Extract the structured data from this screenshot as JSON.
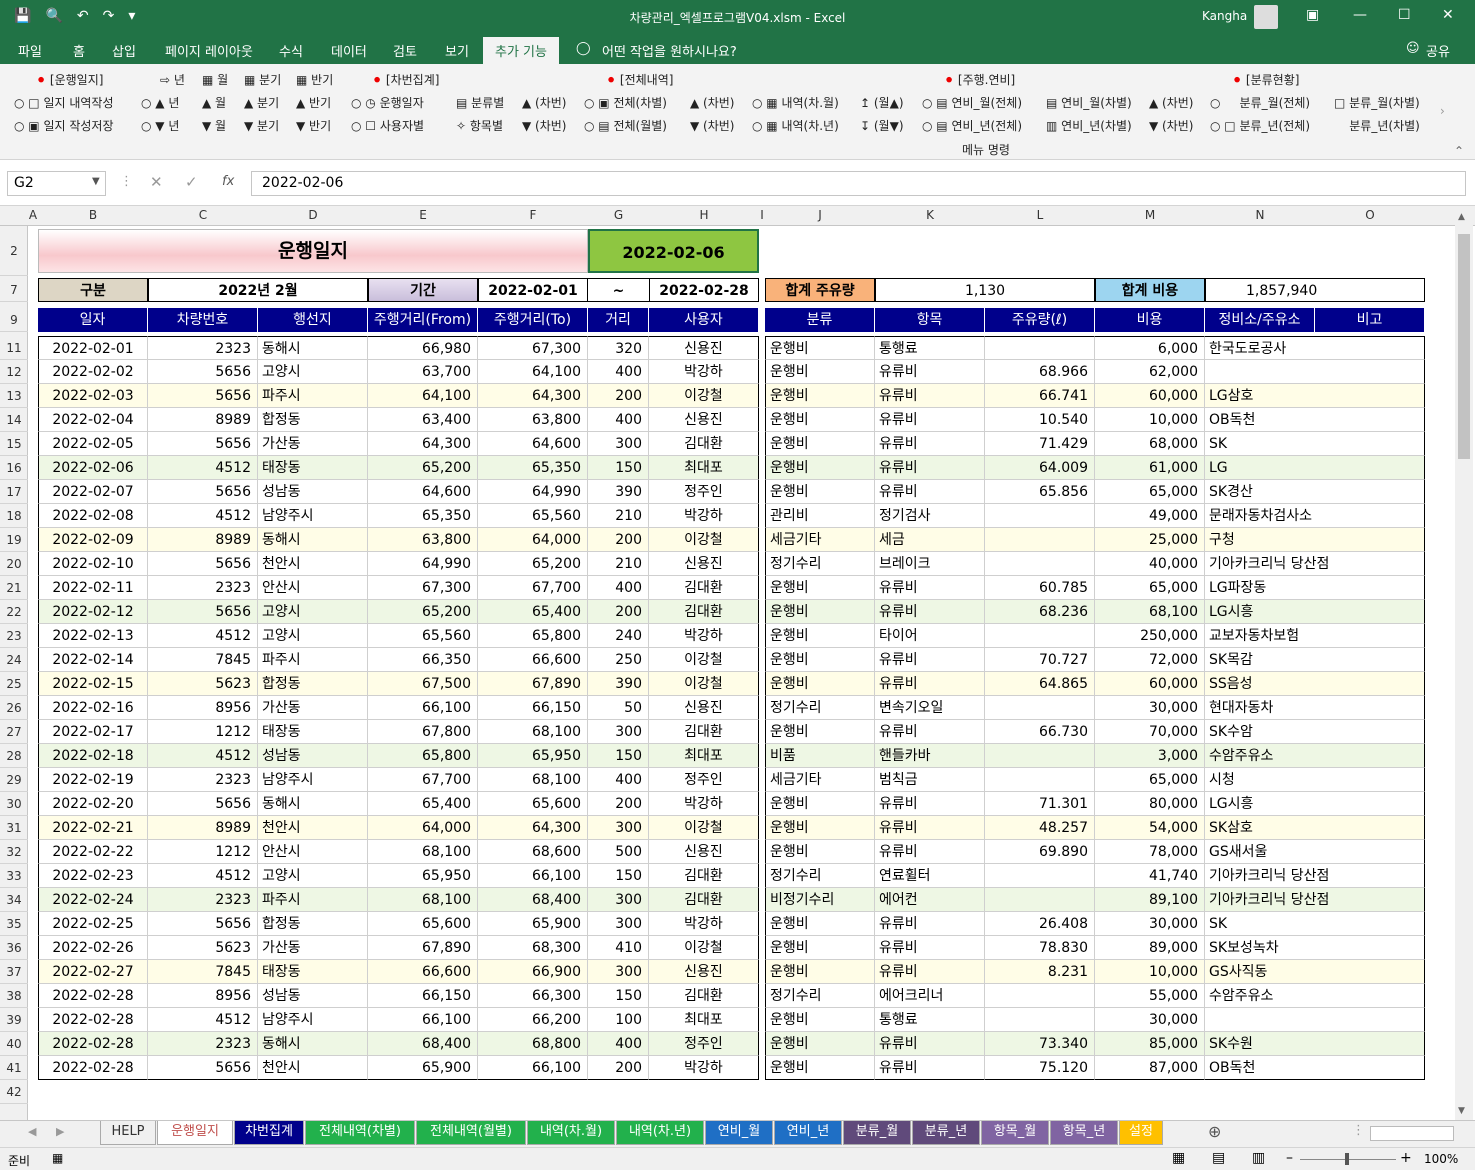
{
  "window": {
    "title": "차량관리_엑셀프로그램V04.xlsm  -  Excel",
    "user": "Kangha"
  },
  "tabs": [
    "파일",
    "홈",
    "삽입",
    "페이지 레이아웃",
    "수식",
    "데이터",
    "검토",
    "보기",
    "추가 기능"
  ],
  "tell_me": "어떤 작업을 원하시나요?",
  "share": "공유",
  "ribbon": {
    "groups": [
      "[운행일지]",
      "[차번집계]",
      "[전체내역]",
      "[주행.연비]",
      "[분류현황]"
    ],
    "row1": [
      "일지 내역작성",
      "년",
      "월",
      "분기",
      "반기",
      "운행일자",
      "분류별",
      "(차번)",
      "전체(차별)",
      "(차번)",
      "내역(차.월)",
      "(월▲)",
      "연비_월(전체)",
      "연비_월(차별)",
      "(차번)",
      "분류_월(전체)",
      "분류_월(차별)"
    ],
    "row2": [
      "일지 작성저장",
      "년",
      "월",
      "분기",
      "반기",
      "사용자별",
      "항목별",
      "(차번)",
      "전체(월별)",
      "(차번)",
      "내역(차.년)",
      "(월▼)",
      "연비_년(전체)",
      "연비_년(차별)",
      "(차번)",
      "분류_년(전체)",
      "분류_년(차별)"
    ],
    "row1b": [
      "년",
      "월",
      "분기",
      "반기"
    ],
    "footer": "메뉴 명령"
  },
  "formula": {
    "cell": "G2",
    "value": "2022-02-06",
    "fx": "fx"
  },
  "columns": [
    "A",
    "B",
    "C",
    "D",
    "E",
    "F",
    "G",
    "H",
    "I",
    "J",
    "K",
    "L",
    "M",
    "N",
    "O"
  ],
  "row_numbers": [
    "2",
    "7",
    "9",
    "11",
    "12",
    "13",
    "14",
    "15",
    "16",
    "17",
    "18",
    "19",
    "20",
    "21",
    "22",
    "23",
    "24",
    "25",
    "26",
    "27",
    "28",
    "29",
    "30",
    "31",
    "32",
    "33",
    "34",
    "35",
    "36",
    "37",
    "38",
    "39",
    "40",
    "41",
    "42"
  ],
  "sheet": {
    "title": "운행일지",
    "date": "2022-02-06",
    "label_gubun": "구분",
    "gubun": "2022년 2월",
    "label_period": "기간",
    "period_from": "2022-02-01",
    "tilde": "~",
    "period_to": "2022-02-28",
    "label_fuel": "합계 주유량",
    "fuel_total": "1,130",
    "label_cost": "합계 비용",
    "cost_total": "1,857,940",
    "left_headers": [
      "일자",
      "차량번호",
      "행선지",
      "주행거리(From)",
      "주행거리(To)",
      "거리",
      "사용자"
    ],
    "right_headers": [
      "분류",
      "항목",
      "주유량(ℓ)",
      "비용",
      "정비소/주유소",
      "비고"
    ],
    "rows": [
      [
        "2022-02-01",
        "2323",
        "동해시",
        "66,980",
        "67,300",
        "320",
        "신용진",
        "운행비",
        "통행료",
        "",
        "6,000",
        "한국도로공사"
      ],
      [
        "2022-02-02",
        "5656",
        "고양시",
        "63,700",
        "64,100",
        "400",
        "박강하",
        "운행비",
        "유류비",
        "68.966",
        "62,000",
        ""
      ],
      [
        "2022-02-03",
        "5656",
        "파주시",
        "64,100",
        "64,300",
        "200",
        "이강철",
        "운행비",
        "유류비",
        "66.741",
        "60,000",
        "LG삼호"
      ],
      [
        "2022-02-04",
        "8989",
        "합정동",
        "63,400",
        "63,800",
        "400",
        "신용진",
        "운행비",
        "유류비",
        "10.540",
        "10,000",
        "OB독천"
      ],
      [
        "2022-02-05",
        "5656",
        "가산동",
        "64,300",
        "64,600",
        "300",
        "김대환",
        "운행비",
        "유류비",
        "71.429",
        "68,000",
        "SK"
      ],
      [
        "2022-02-06",
        "4512",
        "태장동",
        "65,200",
        "65,350",
        "150",
        "최대포",
        "운행비",
        "유류비",
        "64.009",
        "61,000",
        "LG"
      ],
      [
        "2022-02-07",
        "5656",
        "성남동",
        "64,600",
        "64,990",
        "390",
        "정주인",
        "운행비",
        "유류비",
        "65.856",
        "65,000",
        "SK경산"
      ],
      [
        "2022-02-08",
        "4512",
        "남양주시",
        "65,350",
        "65,560",
        "210",
        "박강하",
        "관리비",
        "정기검사",
        "",
        "49,000",
        "문래자동차검사소"
      ],
      [
        "2022-02-09",
        "8989",
        "동해시",
        "63,800",
        "64,000",
        "200",
        "이강철",
        "세금기타",
        "세금",
        "",
        "25,000",
        "구청"
      ],
      [
        "2022-02-10",
        "5656",
        "천안시",
        "64,990",
        "65,200",
        "210",
        "신용진",
        "정기수리",
        "브레이크",
        "",
        "40,000",
        "기아카크리닉 당산점"
      ],
      [
        "2022-02-11",
        "2323",
        "안산시",
        "67,300",
        "67,700",
        "400",
        "김대환",
        "운행비",
        "유류비",
        "60.785",
        "65,000",
        "LG파장동"
      ],
      [
        "2022-02-12",
        "5656",
        "고양시",
        "65,200",
        "65,400",
        "200",
        "김대환",
        "운행비",
        "유류비",
        "68.236",
        "68,100",
        "LG시흥"
      ],
      [
        "2022-02-13",
        "4512",
        "고양시",
        "65,560",
        "65,800",
        "240",
        "박강하",
        "운행비",
        "타이어",
        "",
        "250,000",
        "교보자동차보험"
      ],
      [
        "2022-02-14",
        "7845",
        "파주시",
        "66,350",
        "66,600",
        "250",
        "이강철",
        "운행비",
        "유류비",
        "70.727",
        "72,000",
        "SK목감"
      ],
      [
        "2022-02-15",
        "5623",
        "합정동",
        "67,500",
        "67,890",
        "390",
        "이강철",
        "운행비",
        "유류비",
        "64.865",
        "60,000",
        "SS음성"
      ],
      [
        "2022-02-16",
        "8956",
        "가산동",
        "66,100",
        "66,150",
        "50",
        "신용진",
        "정기수리",
        "변속기오일",
        "",
        "30,000",
        "현대자동차"
      ],
      [
        "2022-02-17",
        "1212",
        "태장동",
        "67,800",
        "68,100",
        "300",
        "김대환",
        "운행비",
        "유류비",
        "66.730",
        "70,000",
        "SK수암"
      ],
      [
        "2022-02-18",
        "4512",
        "성남동",
        "65,800",
        "65,950",
        "150",
        "최대포",
        "비품",
        "핸들카바",
        "",
        "3,000",
        "수암주유소"
      ],
      [
        "2022-02-19",
        "2323",
        "남양주시",
        "67,700",
        "68,100",
        "400",
        "정주인",
        "세금기타",
        "범칙금",
        "",
        "65,000",
        "시청"
      ],
      [
        "2022-02-20",
        "5656",
        "동해시",
        "65,400",
        "65,600",
        "200",
        "박강하",
        "운행비",
        "유류비",
        "71.301",
        "80,000",
        "LG시흥"
      ],
      [
        "2022-02-21",
        "8989",
        "천안시",
        "64,000",
        "64,300",
        "300",
        "이강철",
        "운행비",
        "유류비",
        "48.257",
        "54,000",
        "SK삼호"
      ],
      [
        "2022-02-22",
        "1212",
        "안산시",
        "68,100",
        "68,600",
        "500",
        "신용진",
        "운행비",
        "유류비",
        "69.890",
        "78,000",
        "GS새서울"
      ],
      [
        "2022-02-23",
        "4512",
        "고양시",
        "65,950",
        "66,100",
        "150",
        "김대환",
        "정기수리",
        "연료휠터",
        "",
        "41,740",
        "기아카크리닉 당산점"
      ],
      [
        "2022-02-24",
        "2323",
        "파주시",
        "68,100",
        "68,400",
        "300",
        "김대환",
        "비정기수리",
        "에어컨",
        "",
        "89,100",
        "기아카크리닉 당산점"
      ],
      [
        "2022-02-25",
        "5656",
        "합정동",
        "65,600",
        "65,900",
        "300",
        "박강하",
        "운행비",
        "유류비",
        "26.408",
        "30,000",
        "SK"
      ],
      [
        "2022-02-26",
        "5623",
        "가산동",
        "67,890",
        "68,300",
        "410",
        "이강철",
        "운행비",
        "유류비",
        "78.830",
        "89,000",
        "SK보성녹차"
      ],
      [
        "2022-02-27",
        "7845",
        "태장동",
        "66,600",
        "66,900",
        "300",
        "신용진",
        "운행비",
        "유류비",
        "8.231",
        "10,000",
        "GS사직동"
      ],
      [
        "2022-02-28",
        "8956",
        "성남동",
        "66,150",
        "66,300",
        "150",
        "김대환",
        "정기수리",
        "에어크리너",
        "",
        "55,000",
        "수암주유소"
      ],
      [
        "2022-02-28",
        "4512",
        "남양주시",
        "66,100",
        "66,200",
        "100",
        "최대포",
        "운행비",
        "통행료",
        "",
        "30,000",
        ""
      ],
      [
        "2022-02-28",
        "2323",
        "동해시",
        "68,400",
        "68,800",
        "400",
        "정주인",
        "운행비",
        "유류비",
        "73.340",
        "85,000",
        "SK수원"
      ],
      [
        "2022-02-28",
        "5656",
        "천안시",
        "65,900",
        "66,100",
        "200",
        "박강하",
        "운행비",
        "유류비",
        "75.120",
        "87,000",
        "OB독천"
      ]
    ]
  },
  "sheet_tabs": [
    {
      "label": "HELP",
      "bg": "#f0f0f0",
      "fg": "#333"
    },
    {
      "label": "운행일지",
      "bg": "#ffffff",
      "fg": "#c0504d"
    },
    {
      "label": "차번집계",
      "bg": "#00008b",
      "fg": "#ffffff"
    },
    {
      "label": "전체내역(차별)",
      "bg": "#22b14c",
      "fg": "#ffffff"
    },
    {
      "label": "전체내역(월별)",
      "bg": "#22b14c",
      "fg": "#ffffff"
    },
    {
      "label": "내역(차.월)",
      "bg": "#22b14c",
      "fg": "#ffffff"
    },
    {
      "label": "내역(차.년)",
      "bg": "#22b14c",
      "fg": "#ffffff"
    },
    {
      "label": "연비_월",
      "bg": "#1f6fc5",
      "fg": "#ffffff"
    },
    {
      "label": "연비_년",
      "bg": "#1f6fc5",
      "fg": "#ffffff"
    },
    {
      "label": "분류_월",
      "bg": "#604a7b",
      "fg": "#ffffff"
    },
    {
      "label": "분류_년",
      "bg": "#604a7b",
      "fg": "#ffffff"
    },
    {
      "label": "항목_월",
      "bg": "#8064a2",
      "fg": "#ffffff"
    },
    {
      "label": "항목_년",
      "bg": "#8064a2",
      "fg": "#ffffff"
    },
    {
      "label": "설정",
      "bg": "#ffc000",
      "fg": "#ffffff"
    }
  ],
  "status": {
    "ready": "준비",
    "zoom": "100%"
  },
  "colors": {
    "excel_green": "#217346",
    "header_navy": "#00008b",
    "band_yellow": "#fffde7",
    "band_green": "#eef7e4",
    "date_green": "#8ec641"
  }
}
